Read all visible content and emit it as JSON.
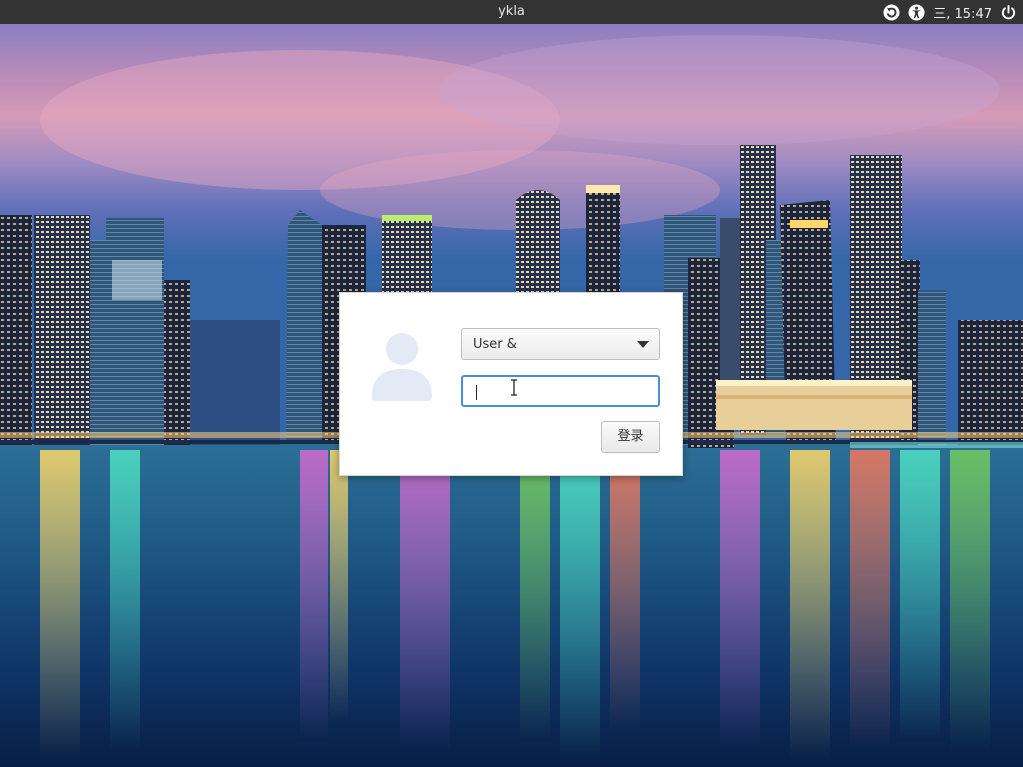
{
  "top_panel": {
    "hostname": "ykla",
    "clock": "三, 15:47",
    "icons": [
      "update-icon",
      "accessibility-icon",
      "power-icon"
    ]
  },
  "login": {
    "user_label": "User &",
    "password_value": "",
    "login_button": "登录"
  },
  "colors": {
    "panel": "#333333",
    "focus_border": "#4a90d9",
    "dialog_bg": "#ffffff"
  }
}
